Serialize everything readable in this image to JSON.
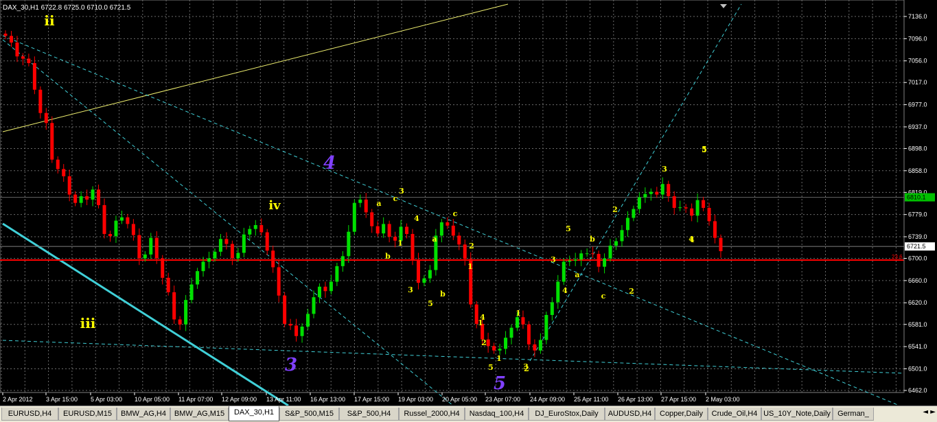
{
  "header": {
    "symbol": "DAX_30,H1",
    "ohlc": "6722.8 6725.0 6710.0 6721.5"
  },
  "colors": {
    "background": "#000000",
    "grid": "#6b6b6b",
    "bull": "#00e000",
    "bear": "#ff0000",
    "cyan": "#40d0d8",
    "yellow": "#ffff00",
    "purple": "#8040ff",
    "red_level": "#ff0000",
    "axis_text": "#ffffff"
  },
  "price_axis": [
    "7136.0",
    "7096.0",
    "7056.0",
    "7017.0",
    "6977.0",
    "6937.0",
    "6898.0",
    "6858.0",
    "6819.0",
    "6779.0",
    "6739.0",
    "6700.0",
    "6660.0",
    "6620.0",
    "6581.0",
    "6541.0",
    "6501.0",
    "6462.0"
  ],
  "time_axis": [
    "2 Apr 2012",
    "3 Apr 15:00",
    "5 Apr 03:00",
    "10 Apr 05:00",
    "11 Apr 07:00",
    "12 Apr 09:00",
    "13 Apr 11:00",
    "16 Apr 13:00",
    "17 Apr 15:00",
    "19 Apr 03:00",
    "20 Apr 05:00",
    "23 Apr 07:00",
    "24 Apr 09:00",
    "25 Apr 11:00",
    "26 Apr 13:00",
    "27 Apr 15:00",
    "2 May 03:00"
  ],
  "labels": {
    "current_price": "6721.5",
    "level_price": "6810.1",
    "fib_label": "23.6"
  },
  "chart_data": {
    "type": "candlestick",
    "title": "DAX_30,H1",
    "ylim": [
      6462,
      7136
    ],
    "ohlc_note": "6722.8 6725.0 6710.0 6721.5",
    "horizontal_levels": [
      {
        "price": 6810.1,
        "label": "6810.1"
      },
      {
        "price": 6721.5,
        "label": "6721.5"
      },
      {
        "price": 6697,
        "label": "23.6"
      }
    ],
    "series_close": [
      7101,
      7089,
      7064,
      7060,
      7052,
      7004,
      6962,
      6944,
      6878,
      6861,
      6848,
      6815,
      6800,
      6812,
      6806,
      6824,
      6796,
      6744,
      6740,
      6768,
      6774,
      6762,
      6742,
      6700,
      6707,
      6737,
      6700,
      6665,
      6639,
      6590,
      6581,
      6625,
      6653,
      6677,
      6694,
      6700,
      6712,
      6735,
      6726,
      6700,
      6710,
      6743,
      6753,
      6760,
      6747,
      6714,
      6684,
      6633,
      6582,
      6579,
      6560,
      6577,
      6600,
      6630,
      6649,
      6641,
      6658,
      6686,
      6704,
      6748,
      6800,
      6806,
      6783,
      6758,
      6745,
      6762,
      6739,
      6732,
      6757,
      6744,
      6698,
      6656,
      6664,
      6679,
      6741,
      6765,
      6759,
      6741,
      6725,
      6699,
      6617,
      6582,
      6554,
      6542,
      6534,
      6537,
      6557,
      6575,
      6594,
      6581,
      6545,
      6534,
      6553,
      6598,
      6621,
      6658,
      6694,
      6696,
      6698,
      6709,
      6709,
      6708,
      6685,
      6700,
      6723,
      6731,
      6751,
      6773,
      6789,
      6810,
      6816,
      6820,
      6815,
      6834,
      6812,
      6791,
      6792,
      6790,
      6777,
      6805,
      6791,
      6767,
      6737,
      6713
    ],
    "wave_labels": [
      "ii",
      "iii",
      "iv",
      "3",
      "4",
      "5",
      "a",
      "b",
      "c",
      "1",
      "2",
      "3",
      "4",
      "5",
      "1",
      "2",
      "3",
      "4",
      "5",
      "a",
      "b",
      "c",
      "1",
      "2",
      "3",
      "4",
      "5",
      "1",
      "2",
      "3",
      "4",
      "5",
      "a",
      "b",
      "c",
      "1",
      "2",
      "3",
      "4",
      "5"
    ]
  },
  "tabs": [
    {
      "label": "EURUSD,H4",
      "active": false
    },
    {
      "label": "EURUSD,M15",
      "active": false
    },
    {
      "label": "BMW_AG,H4",
      "active": false
    },
    {
      "label": "BMW_AG,M15",
      "active": false
    },
    {
      "label": "DAX_30,H1",
      "active": true
    },
    {
      "label": "S&P_500,M15",
      "active": false
    },
    {
      "label": "S&P_500,H4",
      "active": false
    },
    {
      "label": "Russel_2000,H4",
      "active": false
    },
    {
      "label": "Nasdaq_100,H4",
      "active": false
    },
    {
      "label": "DJ_EuroStox,Daily",
      "active": false
    },
    {
      "label": "AUDUSD,H4",
      "active": false
    },
    {
      "label": "Copper,Daily",
      "active": false
    },
    {
      "label": "Crude_Oil,H4",
      "active": false
    },
    {
      "label": "US_10Y_Note,Daily",
      "active": false
    },
    {
      "label": "German_",
      "active": false
    }
  ],
  "tab_nav": {
    "left": "◄",
    "right": "►"
  }
}
